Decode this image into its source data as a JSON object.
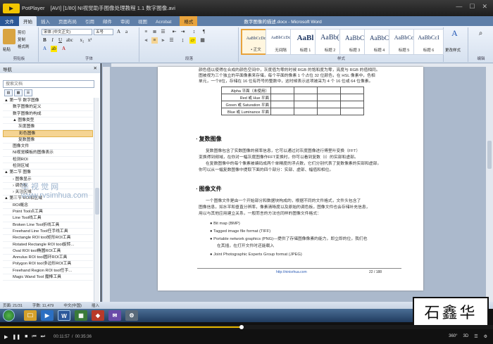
{
  "player": {
    "name": "PotPlayer",
    "file_title": "[AVI]   [1/80] NI视觉助手图像处理教程 1.1 数字图像.avi",
    "controls": [
      "—",
      "☐",
      "✕"
    ]
  },
  "word": {
    "title": "数字图像的描述.docx - Microsoft Word",
    "tabs": [
      "文件",
      "开始",
      "插入",
      "页面布局",
      "引用",
      "邮件",
      "审阅",
      "视图",
      "Acrobat",
      "格式"
    ],
    "context_tab": "图片工具",
    "font_name": "宋体 (中文正文)",
    "font_size": "五号",
    "groups": {
      "clipboard": "剪贴板",
      "font": "字体",
      "paragraph": "段落",
      "styles": "样式",
      "editing": "编辑"
    },
    "clipboard": {
      "paste": "粘贴",
      "cut": "剪切",
      "copy": "复制",
      "format_painter": "格式刷"
    },
    "styles": [
      {
        "sample": "AaBbCcDc",
        "name": "• 正文"
      },
      {
        "sample": "AaBbCcDc",
        "name": "无间隔"
      },
      {
        "sample": "AaBl",
        "name": "标题 1"
      },
      {
        "sample": "AaBb(",
        "name": "标题 2"
      },
      {
        "sample": "AaBbC",
        "name": "标题 3"
      },
      {
        "sample": "AaBbC",
        "name": "标题 4"
      },
      {
        "sample": "AaBbCc",
        "name": "标题 5"
      },
      {
        "sample": "AaBbCcI",
        "name": "标题 6"
      }
    ],
    "change_styles": "更改样式"
  },
  "nav": {
    "title": "导航",
    "search_placeholder": "搜索文档",
    "items": [
      {
        "label": "▲ 第一节  数字图像",
        "level": 0
      },
      {
        "label": "数字图像的定义",
        "level": 1
      },
      {
        "label": "数字图像的构成",
        "level": 1
      },
      {
        "label": "▲ 图像类型",
        "level": 1
      },
      {
        "label": "灰度图像",
        "level": 2
      },
      {
        "label": "彩色图像",
        "level": 2,
        "selected": true
      },
      {
        "label": "复数图像",
        "level": 2
      },
      {
        "label": "图像文件",
        "level": 1
      },
      {
        "label": "NI视觉模板的图像表示",
        "level": 1
      },
      {
        "label": "检测ROI",
        "level": 1
      },
      {
        "label": "检测区域",
        "level": 1
      },
      {
        "label": "▲ 第二节  图像",
        "level": 0
      },
      {
        "label": "› 图像显示",
        "level": 1
      },
      {
        "label": "› 调色板",
        "level": 1
      },
      {
        "label": "› 关注区域",
        "level": 1
      },
      {
        "label": "▲ 第三节  ROI和区域",
        "level": 0
      },
      {
        "label": "ROI概念",
        "level": 1
      },
      {
        "label": "Point Tool点工具",
        "level": 1
      },
      {
        "label": "Line Tool线工具",
        "level": 1
      },
      {
        "label": "Broken Line Tool折线工具",
        "level": 1
      },
      {
        "label": "Freehand Line Tool任手线工具",
        "level": 1
      },
      {
        "label": "Rectangle ROI tool矩形ROI工具",
        "level": 1
      },
      {
        "label": "Rotated Rectangle ROI tool旋转...",
        "level": 1
      },
      {
        "label": "Oval ROI tool椭圆ROI工具",
        "level": 1
      },
      {
        "label": "Annulus ROI tool圆环ROI工具",
        "level": 1
      },
      {
        "label": "Polygon ROI tool多边形ROI工具",
        "level": 1
      },
      {
        "label": "Freehand Region ROI tool任手...",
        "level": 1
      },
      {
        "label": "Magic Wand Tool 魔棒工具",
        "level": 1
      }
    ],
    "watermark": "华 视 觉 网\nwww.rvsimhua.com"
  },
  "doc": {
    "intro_lines": [
      "颜色值以使得在合成的颜色空间中，灰度值为零的时候 RGB 的饱和度为零，亮度与 RGB 的值相同。",
      "图被视为三个独立的平面像素来存储，每个平面的像素 1 个占位 32 位颜色，在 HSL 像素中，色相",
      "单元，一个8位，存储在 16 位有符号的整数中，这时候表示这项被采为 4 个 16 位或 64 位像素。"
    ],
    "table": [
      {
        "label": "Alpha 平面（未使用）",
        "filled": [
          false,
          true,
          false,
          false
        ]
      },
      {
        "label": "Red 或 Hue 平面",
        "filled": [
          false,
          false,
          true,
          false
        ]
      },
      {
        "label": "Green 或 Saturation 平面",
        "filled": [
          false,
          false,
          false,
          true
        ]
      },
      {
        "label": "Blue 或 Luminance 平面",
        "filled": [
          false,
          false,
          false,
          true
        ]
      }
    ],
    "section1_title": "· 复数图像",
    "section1_body": [
      "复数图像包含了实数图像的频率信息，它可以通过对灰度图像进行傅里叶变换（FFT）",
      "变换得到频域，在你对一幅灰度图像作FFT变换时，你可以看到复数（I）的实部和虚部。",
      "在复数图像中的每个像素被编码成两个单精度的浮点数，它们分别代表了复数像素的实部和虚部。",
      "你可以从一幅复数图像中提取下面的四个部分：实部、虚部、幅值和相位。"
    ],
    "section2_title": "· 图像文件",
    "section2_body": [
      "一个图像文件是由一个开始部分和数据块构成的，根据不同的文件格式，文件头包含了",
      "图像信息，如水平和垂直分辨率，像素清晰度以及原始的调色板，图像文件也会存储补充信息，",
      "用以与其他应用建立关系，一般而言的方法也同样的图像文件格式："
    ],
    "bullets": [
      "Bit map (BMP)",
      "Tagged image file format (TIFF)",
      "Portable network graphics (PNG)—提供了存储图像像素的能力，即立即的位，我们也",
      "在其插，在打开文件时还能载入",
      "Joint Photographic Experts Group format (JPEG)"
    ],
    "footer_url": "http://ninisrhua.com",
    "page_number": "22 / 188"
  },
  "status": {
    "page": "页面: 21/31",
    "words": "字数: 11,479",
    "lang": "中文(中国)",
    "mode": "插入"
  },
  "taskbar": {
    "items": [
      "🗀",
      "▶",
      "W",
      "▦",
      "◆",
      "✉",
      "⚙"
    ]
  },
  "overlay_watermark": "石鑫华",
  "playback": {
    "current": "00:11:57",
    "total": "00:35:36",
    "progress_fraction": 0.49,
    "badges": [
      "360°",
      "3D",
      "☰",
      "⚙"
    ]
  }
}
